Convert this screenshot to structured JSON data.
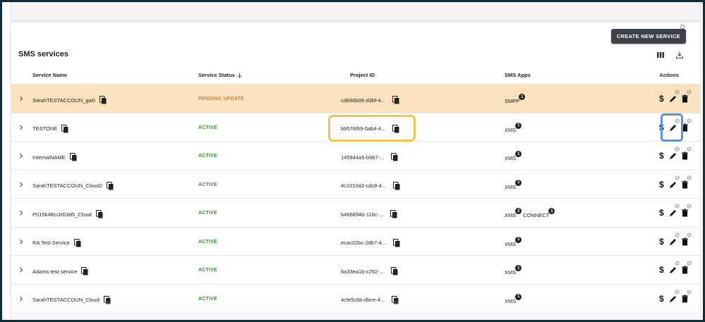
{
  "card": {
    "title": "SMS services",
    "create_button": "CREATE NEW SERVICE"
  },
  "icons": {
    "columns": "view-columns-icon",
    "download": "download-icon",
    "copy": "copy-icon",
    "expand": "chevron-right-icon",
    "edit": "pencil-icon",
    "delete": "trash-icon",
    "billing": "dollar-icon",
    "pin": "pin-icon"
  },
  "headers": {
    "name": "Service Name",
    "status": "Service Status",
    "project": "Project ID",
    "apps": "SMS Apps",
    "actions": "Actions"
  },
  "rows": [
    {
      "name": "SarahTESTACCOUN_gw0",
      "status": "PENDING UPDATE",
      "project": "cd666b09-d3bf-4...",
      "apps": [
        {
          "label": "SMPP",
          "count": "1"
        }
      ]
    },
    {
      "name": "TESTONE",
      "status": "ACTIVE",
      "project": "b9576f69-0ab4-4...",
      "apps": [
        {
          "label": "XMS",
          "count": "1"
        }
      ]
    },
    {
      "name": "InternalNAME",
      "status": "ACTIVE",
      "project": "145944a5-b9b7-...",
      "apps": [
        {
          "label": "XMS",
          "count": "1"
        }
      ]
    },
    {
      "name": "SarahTESTACCOUN_Cloud2",
      "status": "ACTIVE",
      "project": "4c1010a3-cdc8-4...",
      "apps": [
        {
          "label": "XMS",
          "count": "1"
        }
      ]
    },
    {
      "name": "P015k4BciJrD3d5_Cloud",
      "status": "ACTIVE",
      "project": "b466894b-116c-...",
      "apps": [
        {
          "label": "XMS",
          "count": "2"
        },
        {
          "label": "CONNECT",
          "count": "1"
        }
      ]
    },
    {
      "name": "RA Test Service",
      "status": "ACTIVE",
      "project": "ecac02bc-2db7-4...",
      "apps": [
        {
          "label": "XMS",
          "count": "1"
        }
      ]
    },
    {
      "name": "Adams test service",
      "status": "ACTIVE",
      "project": "6a33ea1b-c292-...",
      "apps": [
        {
          "label": "XMS",
          "count": "1"
        }
      ]
    },
    {
      "name": "SarahTESTACCOUN_Cloud",
      "status": "ACTIVE",
      "project": "4cfe5cbb-dbce-4...",
      "apps": [
        {
          "label": "XMS",
          "count": "1"
        }
      ]
    }
  ],
  "colors": {
    "pending_row": "#f9e2bd",
    "active_status": "#3f8a3a",
    "pending_status": "#e07c2a",
    "highlight_project": "#f6c24a",
    "highlight_edit": "#5b93d3"
  }
}
